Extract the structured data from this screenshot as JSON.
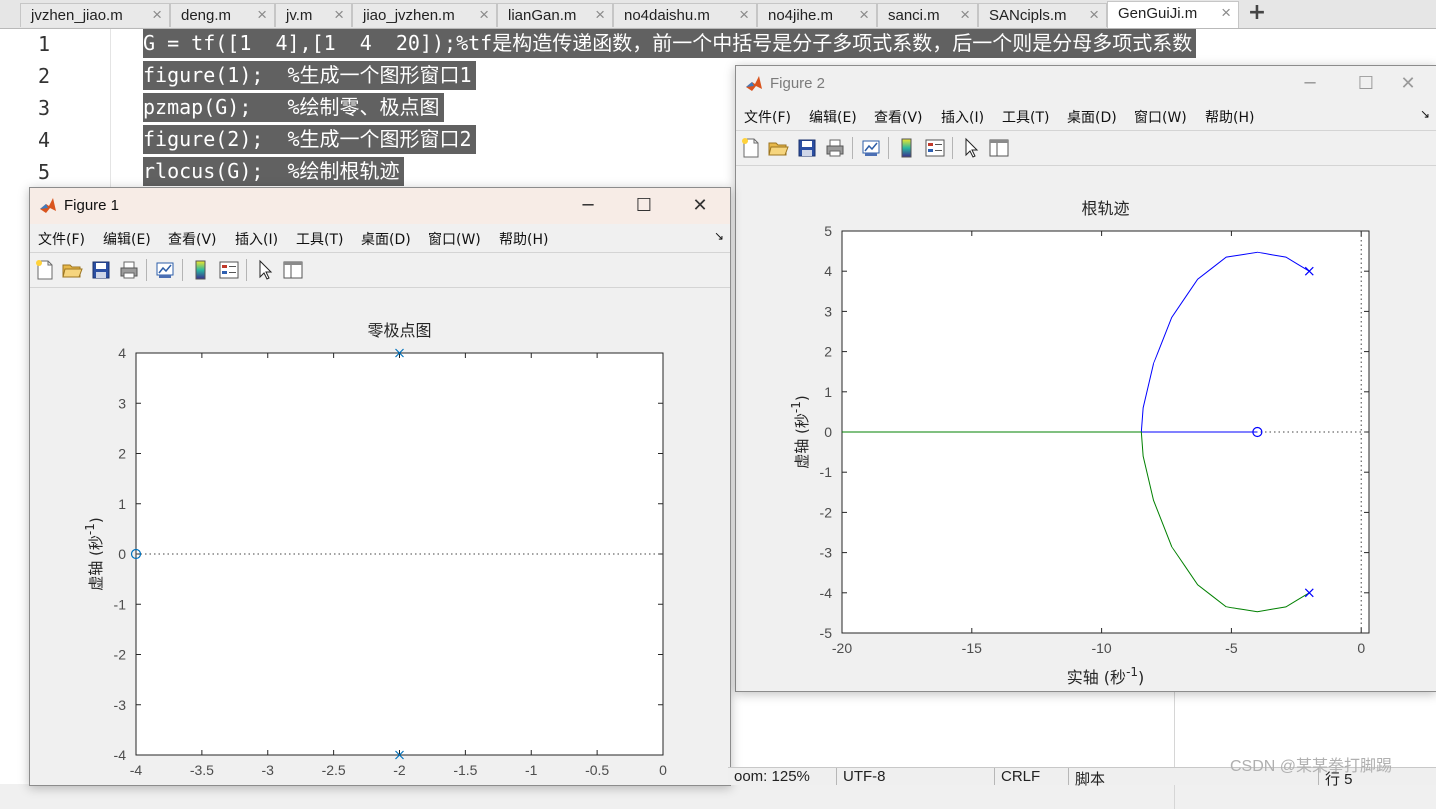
{
  "tabs": [
    {
      "label": "jvzhen_jiao.m"
    },
    {
      "label": "deng.m"
    },
    {
      "label": "jv.m"
    },
    {
      "label": "jiao_jvzhen.m"
    },
    {
      "label": "lianGan.m"
    },
    {
      "label": "no4daishu.m"
    },
    {
      "label": "no4jihe.m"
    },
    {
      "label": "sanci.m"
    },
    {
      "label": "SANcipls.m"
    },
    {
      "label": "GenGuiJi.m",
      "active": true
    }
  ],
  "add_tab": "+",
  "close_glyph": "×",
  "editor": {
    "line_numbers": [
      "1",
      "2",
      "3",
      "4",
      "5"
    ],
    "lines": [
      "G = tf([1  4],[1  4  20]);%tf是构造传递函数，前一个中括号是分子多项式系数，后一个则是分母多项式系数",
      "figure(1);  %生成一个图形窗口1",
      "pzmap(G);   %绘制零、极点图",
      "figure(2);  %生成一个图形窗口2",
      "rlocus(G);  %绘制根轨迹"
    ]
  },
  "status": {
    "zoom": "oom: 125%",
    "encoding": "UTF-8",
    "line_ending": "CRLF",
    "file_type": "脚本",
    "position": "行  5"
  },
  "watermark": "CSDN @某某拳打脚踢",
  "window_buttons": {
    "minimize": "─",
    "maximize": "☐",
    "close": "✕"
  },
  "menus": [
    "文件(F)",
    "编辑(E)",
    "查看(V)",
    "插入(I)",
    "工具(T)",
    "桌面(D)",
    "窗口(W)",
    "帮助(H)"
  ],
  "menu_overflow": "↘",
  "toolbar_icons": [
    "new-figure-icon",
    "open-file-icon",
    "save-icon",
    "print-icon",
    "link-plot-icon",
    "colorbar-icon",
    "legend-icon",
    "pointer-icon",
    "property-editor-icon"
  ],
  "figure1": {
    "title": "Figure 1"
  },
  "figure2": {
    "title": "Figure 2"
  },
  "chart_data": [
    {
      "type": "scatter",
      "title": "零极点图",
      "xlabel": "",
      "ylabel": "虚轴 (秒",
      "ylabel_sup": "-1",
      "ylabel_tail": ")",
      "xlim": [
        -4,
        0
      ],
      "ylim": [
        -4,
        4
      ],
      "x_ticks": [
        -4,
        -3.5,
        -3,
        -2.5,
        -2,
        -1.5,
        -1,
        -0.5,
        0
      ],
      "y_ticks": [
        -4,
        -3,
        -2,
        -1,
        0,
        1,
        2,
        3,
        4
      ],
      "color": "#0072bd",
      "points": [
        {
          "x": -2,
          "y": 4,
          "marker": "x"
        },
        {
          "x": -2,
          "y": -4,
          "marker": "x"
        },
        {
          "x": -4,
          "y": 0,
          "marker": "o"
        }
      ]
    },
    {
      "type": "line",
      "title": "根轨迹",
      "xlabel": "实轴 (秒",
      "xlabel_sup": "-1",
      "xlabel_tail": ")",
      "ylabel": "虚轴 (秒",
      "ylabel_sup": "-1",
      "ylabel_tail": ")",
      "xlim": [
        -20,
        0.3
      ],
      "ylim": [
        -5,
        5
      ],
      "x_ticks": [
        -20,
        -15,
        -10,
        -5,
        0
      ],
      "y_ticks": [
        -5,
        -4,
        -3,
        -2,
        -1,
        0,
        1,
        2,
        3,
        4,
        5
      ],
      "series": [
        {
          "color": "#0000ff",
          "points": [
            [
              -2,
              4
            ],
            [
              -2.9,
              4.35
            ],
            [
              -4,
              4.47
            ],
            [
              -5.2,
              4.35
            ],
            [
              -6.3,
              3.8
            ],
            [
              -7.3,
              2.85
            ],
            [
              -8.0,
              1.7
            ],
            [
              -8.4,
              0.6
            ],
            [
              -8.47,
              0
            ],
            [
              -6.3,
              0
            ],
            [
              -4,
              0
            ]
          ]
        },
        {
          "color": "#008000",
          "points": [
            [
              -2,
              -4
            ],
            [
              -2.9,
              -4.35
            ],
            [
              -4,
              -4.47
            ],
            [
              -5.2,
              -4.35
            ],
            [
              -6.3,
              -3.8
            ],
            [
              -7.3,
              -2.85
            ],
            [
              -8.0,
              -1.7
            ],
            [
              -8.4,
              -0.6
            ],
            [
              -8.47,
              0
            ],
            [
              -12,
              0
            ],
            [
              -16,
              0
            ],
            [
              -20,
              0
            ]
          ]
        }
      ],
      "poles": [
        {
          "x": -2,
          "y": 4
        },
        {
          "x": -2,
          "y": -4
        }
      ],
      "zeros": [
        {
          "x": -4,
          "y": 0
        }
      ]
    }
  ]
}
